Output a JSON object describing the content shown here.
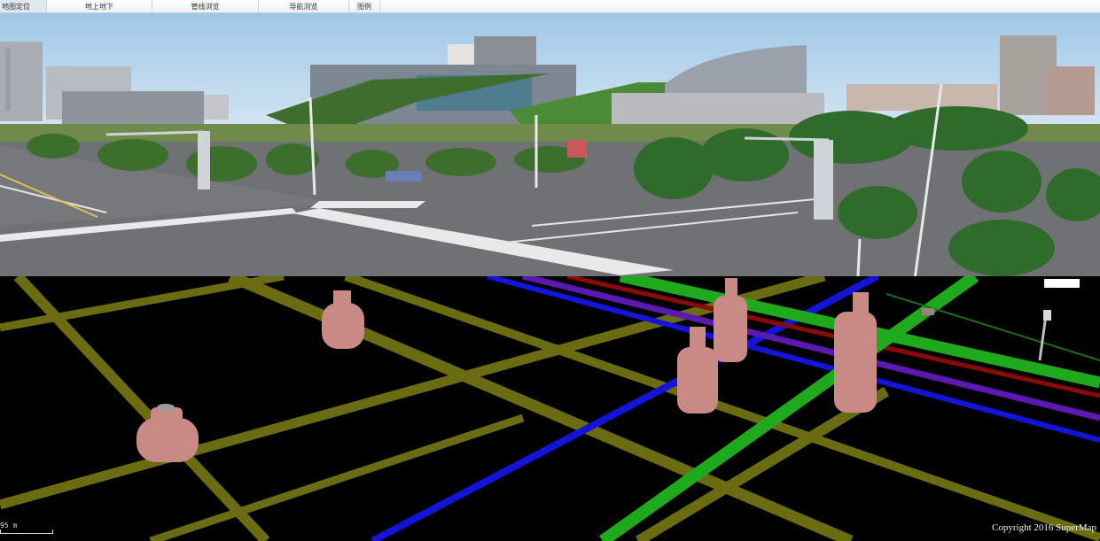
{
  "menu": {
    "items": [
      {
        "label": "地图定位"
      },
      {
        "label": "地上地下"
      },
      {
        "label": "管线浏览"
      },
      {
        "label": "导航浏览"
      },
      {
        "label": "图例"
      }
    ]
  },
  "scale": {
    "label": "95 m"
  },
  "copyright": "Copyright 2016 SuperMap",
  "colors": {
    "pipe_olive": "#6b6b12",
    "pipe_green": "#1fa91c",
    "pipe_blue": "#1414d8",
    "pipe_purple": "#5a19b0",
    "pipe_red": "#8a0a0a",
    "manhole": "#c98a86",
    "sky": "#cfe2f2",
    "road": "#6f7175"
  }
}
